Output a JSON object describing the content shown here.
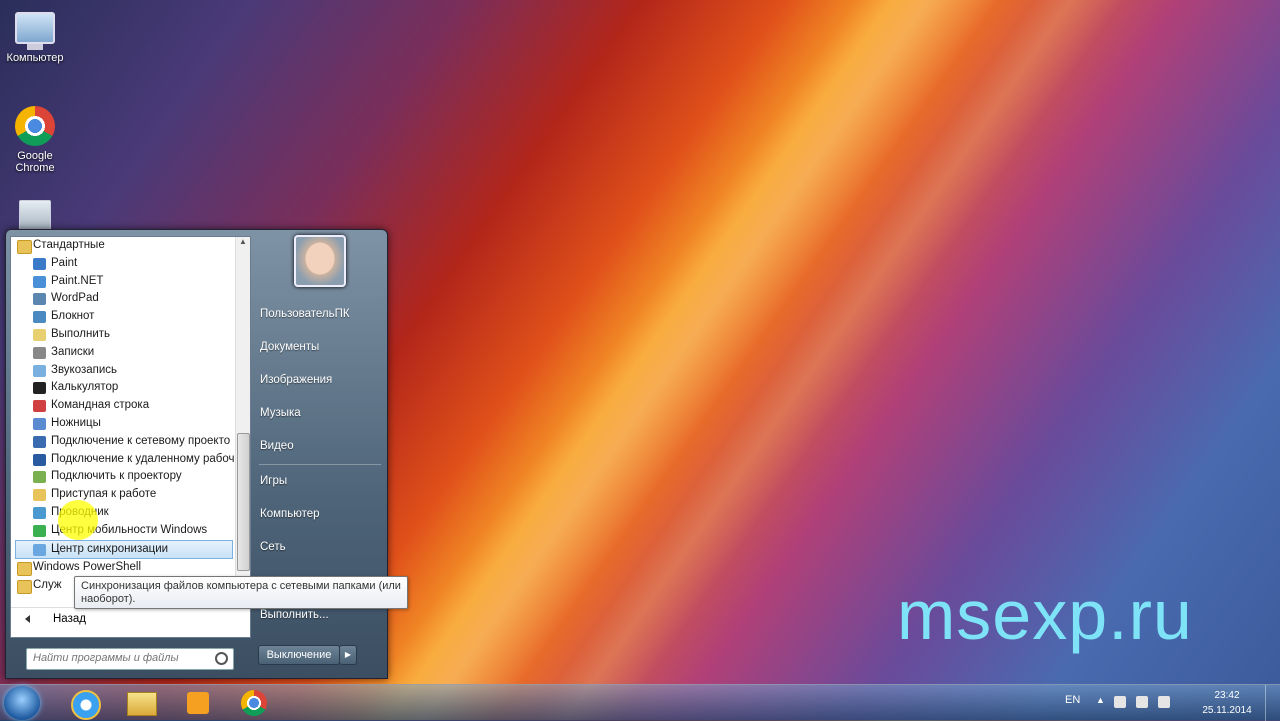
{
  "desktop": {
    "icons": [
      {
        "label": "Компьютер",
        "icon": "computer-icon"
      },
      {
        "label": "Google Chrome",
        "icon": "chrome-icon"
      },
      {
        "label": "",
        "icon": "recycle-bin-icon"
      }
    ]
  },
  "start_menu": {
    "programs": [
      {
        "label": "Стандартные",
        "icon": "folder-icon",
        "folder": true
      },
      {
        "label": "Paint",
        "icon": "paint-icon"
      },
      {
        "label": "Paint.NET",
        "icon": "paintnet-icon"
      },
      {
        "label": "WordPad",
        "icon": "wordpad-icon"
      },
      {
        "label": "Блокнот",
        "icon": "notepad-icon"
      },
      {
        "label": "Выполнить",
        "icon": "run-icon"
      },
      {
        "label": "Записки",
        "icon": "sticky-notes-icon"
      },
      {
        "label": "Звукозапись",
        "icon": "microphone-icon"
      },
      {
        "label": "Калькулятор",
        "icon": "calculator-icon"
      },
      {
        "label": "Командная строка",
        "icon": "cmd-icon"
      },
      {
        "label": "Ножницы",
        "icon": "scissors-icon"
      },
      {
        "label": "Подключение к сетевому проекто",
        "icon": "network-projector-icon"
      },
      {
        "label": "Подключение к удаленному рабоч",
        "icon": "remote-desktop-icon"
      },
      {
        "label": "Подключить к проектору",
        "icon": "projector-icon"
      },
      {
        "label": "Приступая к работе",
        "icon": "getting-started-icon"
      },
      {
        "label": "Проводник",
        "icon": "explorer-icon"
      },
      {
        "label": "Центр мобильности Windows",
        "icon": "mobility-center-icon"
      },
      {
        "label": "Центр синхронизации",
        "icon": "sync-center-icon",
        "selected": true
      },
      {
        "label": "Windows PowerShell",
        "icon": "folder-icon",
        "folder": true
      },
      {
        "label": "Служ",
        "icon": "folder-icon",
        "folder": true
      }
    ],
    "back_label": "Назад",
    "search_placeholder": "Найти программы и файлы",
    "right_items": {
      "user": "ПользовательПК",
      "documents": "Документы",
      "pictures": "Изображения",
      "music": "Музыка",
      "video": "Видео",
      "games": "Игры",
      "computer": "Компьютер",
      "network": "Сеть",
      "run": "Выполнить..."
    },
    "shutdown_label": "Выключение",
    "tooltip": "Синхронизация файлов компьютера с сетевыми папками (или наоборот)."
  },
  "watermark": "msexp.ru",
  "taskbar": {
    "pinned": [
      "internet-explorer-icon",
      "explorer-icon",
      "media-player-icon",
      "chrome-icon"
    ],
    "tray": {
      "language": "EN",
      "time": "23:42",
      "date": "25.11.2014"
    }
  }
}
